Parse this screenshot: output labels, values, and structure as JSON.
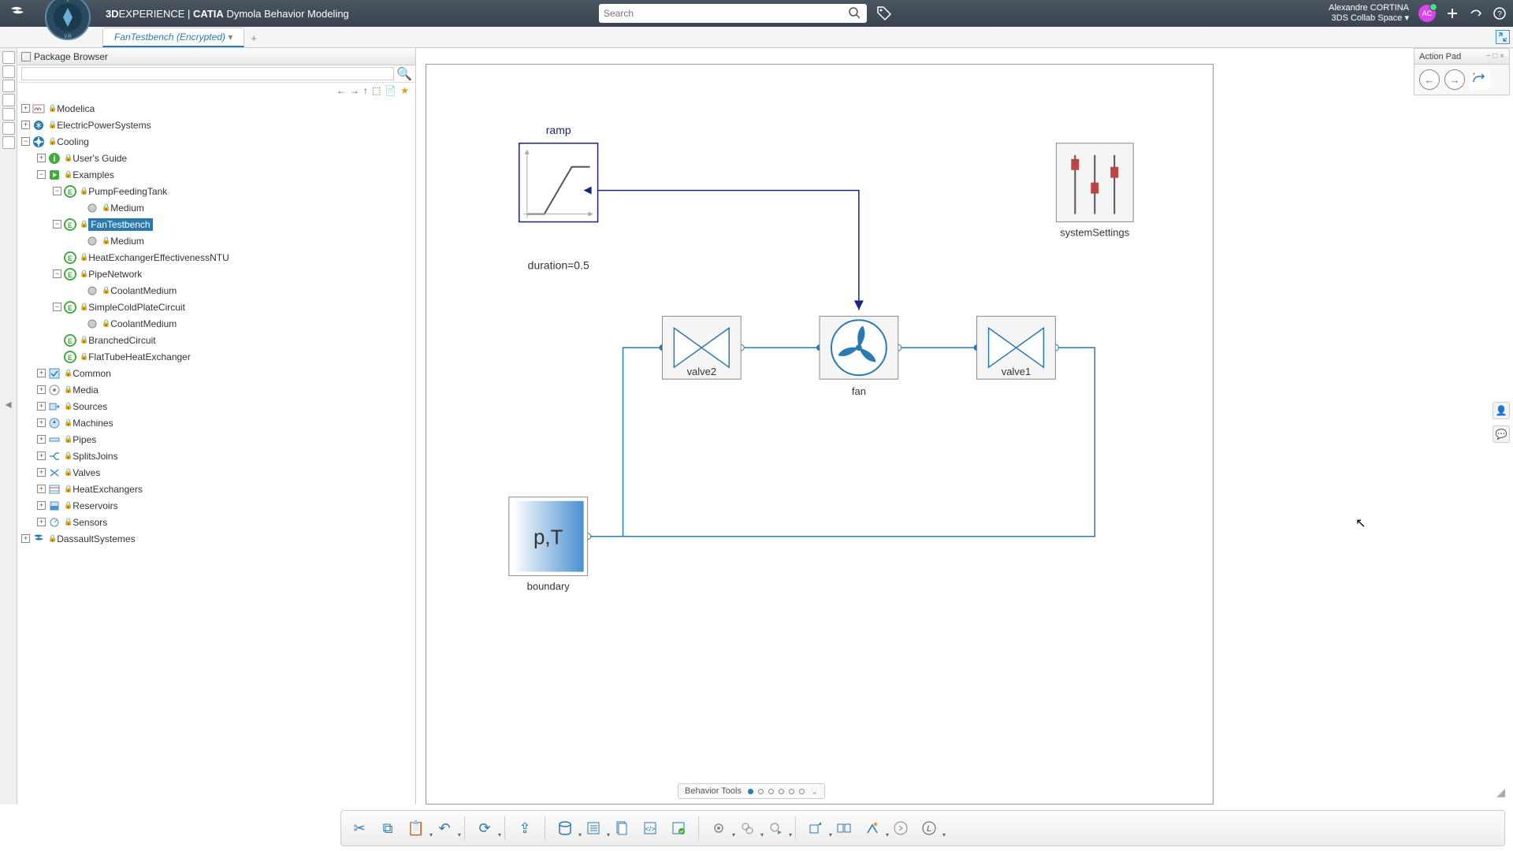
{
  "header": {
    "brand_prefix": "3D",
    "brand_exp": "EXPERIENCE",
    "brand_sep": " | ",
    "brand_catia": "CATIA",
    "app_name": "Dymola Behavior Modeling",
    "search_placeholder": "Search",
    "user_name": "Alexandre CORTINA",
    "collab_space": "3DS Collab Space",
    "avatar_initials": "AC"
  },
  "tab": {
    "title": "FanTestbench (Encrypted)"
  },
  "package_browser": {
    "title": "Package Browser"
  },
  "tree": {
    "root1": "Modelica",
    "root2": "ElectricPowerSystems",
    "root3": "Cooling",
    "ug": "User's Guide",
    "examples": "Examples",
    "pft": "PumpFeedingTank",
    "medium": "Medium",
    "ftb": "FanTestbench",
    "hex": "HeatExchangerEffectivenessNTU",
    "pipe": "PipeNetwork",
    "coolant": "CoolantMedium",
    "scp": "SimpleColdPlateCircuit",
    "branched": "BranchedCircuit",
    "fthe": "FlatTubeHeatExchanger",
    "common": "Common",
    "media": "Media",
    "sources": "Sources",
    "machines": "Machines",
    "pipes": "Pipes",
    "splits": "SplitsJoins",
    "valves": "Valves",
    "heatex": "HeatExchangers",
    "reservoirs": "Reservoirs",
    "sensors": "Sensors",
    "ds": "DassaultSystemes"
  },
  "diagram": {
    "ramp": "ramp",
    "ramp_param": "duration=0.5",
    "valve2": "valve2",
    "fan": "fan",
    "valve1": "valve1",
    "systemSettings": "systemSettings",
    "boundary": "boundary",
    "boundary_txt": "p,T"
  },
  "action_pad": {
    "title": "Action Pad"
  },
  "behavior_tools": {
    "label": "Behavior Tools"
  }
}
